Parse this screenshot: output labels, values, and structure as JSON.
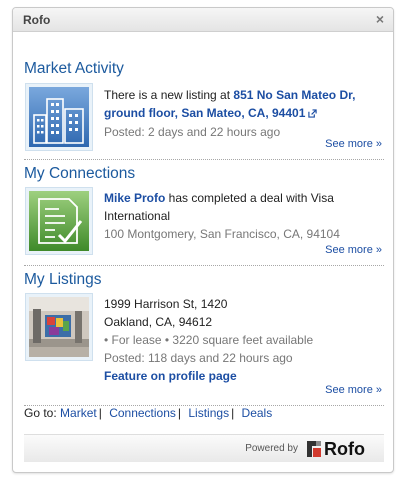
{
  "widget": {
    "title": "Rofo",
    "close_symbol": "×"
  },
  "sections": [
    {
      "heading": "Market Activity",
      "icon": "buildings-icon",
      "text_prefix": "There is a new listing at ",
      "link_text": "851 No San Mateo Dr, ground floor, San Mateo, CA, 94401",
      "posted": "Posted: 2 days and 22 hours ago",
      "see_more": "See more »"
    },
    {
      "heading": "My Connections",
      "icon": "document-check-icon",
      "person": "Mike Profo",
      "text_suffix": " has completed a deal with Visa International",
      "address": "100 Montgomery, San Francisco, CA, 94104",
      "see_more": "See more »"
    },
    {
      "heading": "My Listings",
      "icon": "lobby-photo",
      "address_line1": "1999 Harrison St, 1420",
      "address_line2": "Oakland, CA, 94612",
      "details": "• For lease • 3220 square feet available",
      "posted": "Posted: 118 days and 22 hours ago",
      "feature_link": "Feature on profile page",
      "see_more": "See more »"
    }
  ],
  "goto": {
    "label": "Go to:",
    "links": [
      "Market",
      "Connections",
      "Listings",
      "Deals"
    ],
    "separator": "|"
  },
  "footer": {
    "powered_by": "Powered by",
    "brand": "Rofo"
  },
  "colors": {
    "heading": "#1c5a9e",
    "link": "#1c4ea3",
    "icon_blue": "#4d86c6",
    "icon_green": "#5aa23a"
  }
}
